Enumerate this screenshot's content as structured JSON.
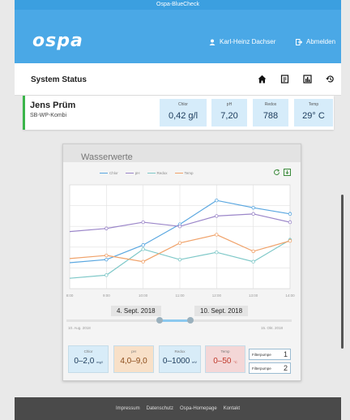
{
  "window": {
    "title": "Ospa-BlueCheck"
  },
  "header": {
    "logo": "ospa",
    "user": "Karl-Heinz Dachser",
    "logout": "Abmelden"
  },
  "status": {
    "title": "System Status",
    "icons": [
      "home-icon",
      "document-icon",
      "chart-icon",
      "history-icon"
    ]
  },
  "pool": {
    "name": "Jens Prüm",
    "model": "SB-WP-Kombi",
    "metrics": [
      {
        "label": "Chlor",
        "value": "0,42 g/l"
      },
      {
        "label": "pH",
        "value": "7,20"
      },
      {
        "label": "Redox",
        "value": "788"
      },
      {
        "label": "Temp",
        "value": "29° C"
      }
    ]
  },
  "panel": {
    "title": "Wasserwerte"
  },
  "chart_data": {
    "type": "line",
    "title": "",
    "legend_position": "top",
    "x": [
      "9:00",
      "10:00",
      "11:00",
      "12:00",
      "13:00",
      "14:00"
    ],
    "x_ticks": [
      "8:00",
      "9:00",
      "10:00",
      "11:00",
      "12:00",
      "13:00",
      "14:00"
    ],
    "series": [
      {
        "name": "Chlor",
        "color": "#5aa7e0",
        "values": [
          0.28,
          0.42,
          0.62,
          0.85,
          0.78,
          0.72
        ]
      },
      {
        "name": "pH",
        "color": "#9b86c9",
        "values": [
          0.58,
          0.64,
          0.6,
          0.7,
          0.72,
          0.64
        ]
      },
      {
        "name": "Redox",
        "color": "#7ec8c8",
        "values": [
          0.13,
          0.38,
          0.28,
          0.35,
          0.26,
          0.47
        ]
      },
      {
        "name": "Temp",
        "color": "#f0a26a",
        "values": [
          0.32,
          0.26,
          0.44,
          0.52,
          0.36,
          0.46
        ]
      }
    ],
    "grid": true
  },
  "range": {
    "from": "4. Sept. 2018",
    "to": "10. Sept. 2018",
    "min": "10. Aug. 2018",
    "max": "15. Okt. 2018"
  },
  "summary": [
    {
      "label": "Chlor",
      "value": "0–2,0",
      "unit": "mg/l",
      "color": "#1b3a5a",
      "bg": "#d8ecf8"
    },
    {
      "label": "pH",
      "value": "4,0–9,0",
      "unit": "",
      "color": "#8a4a18",
      "bg": "#f8e0c8"
    },
    {
      "label": "Redox",
      "value": "0–1000",
      "unit": "mV",
      "color": "#1b3a5a",
      "bg": "#d8ecf8"
    },
    {
      "label": "Temp",
      "value": "0–50",
      "unit": "°C",
      "color": "#c0392b",
      "bg": "#f4d7d7"
    }
  ],
  "pumps": [
    {
      "label": "Filterpumpe",
      "num": "1"
    },
    {
      "label": "Filterpumpe",
      "num": "2"
    }
  ],
  "footer": {
    "links": [
      "Impressum",
      "Datenschutz",
      "Ospa-Homepage",
      "Kontakt"
    ]
  }
}
